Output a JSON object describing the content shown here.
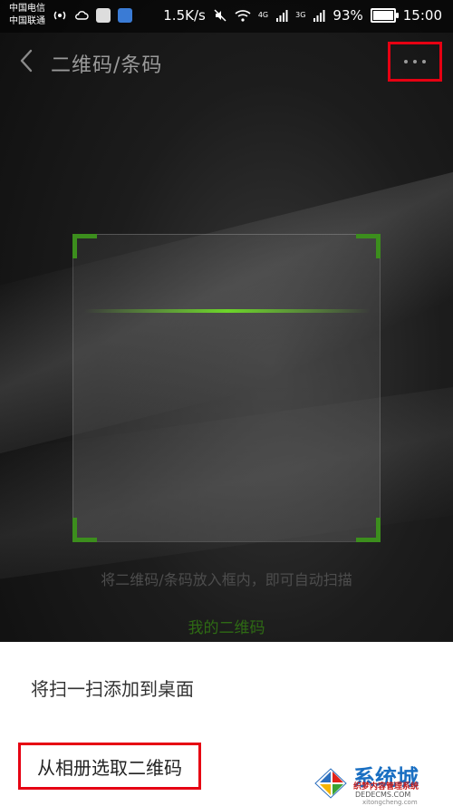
{
  "status_bar": {
    "carrier_1": "中国电信",
    "carrier_2": "中国联通",
    "speed": "1.5K/s",
    "network_1": "4G",
    "network_2": "3G",
    "battery_percent": "93%",
    "battery_level": 0.93,
    "time": "15:00"
  },
  "header": {
    "title": "二维码/条码"
  },
  "scanner": {
    "hint": "将二维码/条码放入框内，即可自动扫描",
    "my_qr_link": "我的二维码"
  },
  "sheet": {
    "items": [
      {
        "label": "将扫一扫添加到桌面"
      },
      {
        "label": "从相册选取二维码"
      }
    ]
  },
  "watermark": {
    "brand": "系统城",
    "tagline": "织梦内容管理系统",
    "domain": "DEDECMS.COM",
    "url": "xitongcheng.com"
  },
  "colors": {
    "highlight": "#e60012",
    "accent_green": "#3c8e1d",
    "sheet_background": "#ffffff"
  }
}
